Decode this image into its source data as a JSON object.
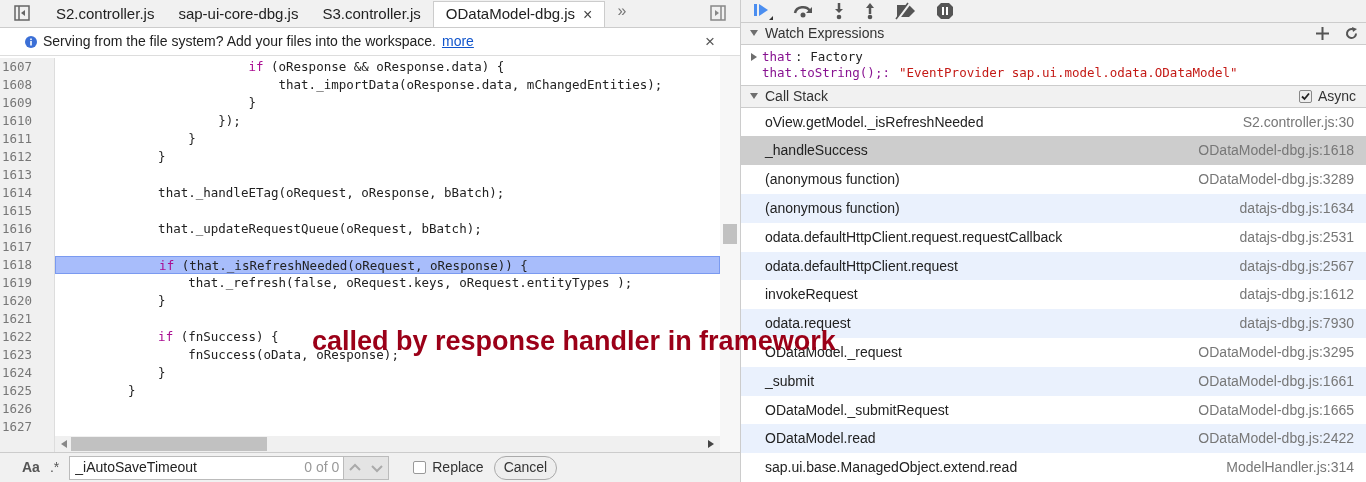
{
  "tabs": [
    {
      "label": "S2.controller.js",
      "selected": false
    },
    {
      "label": "sap-ui-core-dbg.js",
      "selected": false
    },
    {
      "label": "S3.controller.js",
      "selected": false
    },
    {
      "label": "ODataModel-dbg.js",
      "selected": true,
      "close": "×"
    }
  ],
  "more_tabs": "»",
  "infobar": {
    "message": "Serving from the file system? Add your files into the workspace.",
    "link": "more",
    "close": "×"
  },
  "code": [
    {
      "number": "1607",
      "highlighted": false,
      "segments": [
        {
          "text": "                if",
          "kind": "keyword"
        },
        {
          "text": " (oResponse && oResponse.data) {",
          "kind": "plain"
        }
      ]
    },
    {
      "number": "1608",
      "highlighted": false,
      "segments": [
        {
          "text": "                    that._importData(oResponse.data, mChangedEntities);",
          "kind": "plain"
        }
      ]
    },
    {
      "number": "1609",
      "highlighted": false,
      "segments": [
        {
          "text": "                }",
          "kind": "plain"
        }
      ]
    },
    {
      "number": "1610",
      "highlighted": false,
      "segments": [
        {
          "text": "            });",
          "kind": "plain"
        }
      ]
    },
    {
      "number": "1611",
      "highlighted": false,
      "segments": [
        {
          "text": "        }",
          "kind": "plain"
        }
      ]
    },
    {
      "number": "1612",
      "highlighted": false,
      "segments": [
        {
          "text": "    }",
          "kind": "plain"
        }
      ]
    },
    {
      "number": "1613",
      "highlighted": false
    },
    {
      "number": "1614",
      "highlighted": false,
      "segments": [
        {
          "text": "    that._handleETag(oRequest, oResponse, bBatch);",
          "kind": "plain"
        }
      ]
    },
    {
      "number": "1615",
      "highlighted": false
    },
    {
      "number": "1616",
      "highlighted": false,
      "segments": [
        {
          "text": "    that._updateRequestQueue(oRequest, bBatch);",
          "kind": "plain"
        }
      ]
    },
    {
      "number": "1617",
      "highlighted": false
    },
    {
      "number": "1618",
      "highlighted": true,
      "segments": [
        {
          "text": "    if",
          "kind": "keyword"
        },
        {
          "text": " (that._isRefreshNeeded(oRequest, oResponse)) {",
          "kind": "plain"
        }
      ]
    },
    {
      "number": "1619",
      "highlighted": false,
      "segments": [
        {
          "text": "        that._refresh(false, oRequest.keys, oRequest.entityTypes );",
          "kind": "plain"
        }
      ]
    },
    {
      "number": "1620",
      "highlighted": false,
      "segments": [
        {
          "text": "    }",
          "kind": "plain"
        }
      ]
    },
    {
      "number": "1621",
      "highlighted": false
    },
    {
      "number": "1622",
      "highlighted": false,
      "segments": [
        {
          "text": "    if",
          "kind": "keyword"
        },
        {
          "text": " (fnSuccess) {",
          "kind": "plain"
        }
      ]
    },
    {
      "number": "1623",
      "highlighted": false,
      "segments": [
        {
          "text": "        fnSuccess(oData, oResponse);",
          "kind": "plain"
        }
      ]
    },
    {
      "number": "1624",
      "highlighted": false,
      "segments": [
        {
          "text": "    }",
          "kind": "plain"
        }
      ]
    },
    {
      "number": "1625",
      "highlighted": false,
      "segments": [
        {
          "text": "}",
          "kind": "plain"
        }
      ]
    },
    {
      "number": "1626",
      "highlighted": false
    },
    {
      "number": "1627",
      "highlighted": false
    }
  ],
  "annotation": "called by response handler in framework",
  "search": {
    "case_toggle": "Aa",
    "regex_toggle": ".*",
    "value": "_iAutoSaveTimeout",
    "count": "0 of 0",
    "replace_label": "Replace",
    "replace_checked": false,
    "cancel": "Cancel"
  },
  "watch": {
    "title": "Watch Expressions",
    "expanded": true,
    "items": [
      {
        "name": "that",
        "value": ": Factory",
        "kind": "object"
      },
      {
        "name": "that.toString();:",
        "value": "\"EventProvider sap.ui.model.odata.ODataModel\"",
        "kind": "string"
      }
    ]
  },
  "call_stack": {
    "title": "Call Stack",
    "expanded": true,
    "async_label": "Async",
    "async_checked": true,
    "frames": [
      {
        "function": "oView.getModel._isRefreshNeeded",
        "location": "S2.controller.js:30",
        "selected": false,
        "async": false
      },
      {
        "function": "_handleSuccess",
        "location": "ODataModel-dbg.js:1618",
        "selected": true,
        "async": false
      },
      {
        "function": "(anonymous function)",
        "location": "ODataModel-dbg.js:3289",
        "selected": false,
        "async": false
      },
      {
        "function": "(anonymous function)",
        "location": "datajs-dbg.js:1634",
        "selected": false,
        "async": true
      },
      {
        "function": "odata.defaultHttpClient.request.requestCallback",
        "location": "datajs-dbg.js:2531",
        "selected": false,
        "async": false
      },
      {
        "function": "odata.defaultHttpClient.request",
        "location": "datajs-dbg.js:2567",
        "selected": false,
        "async": true
      },
      {
        "function": "invokeRequest",
        "location": "datajs-dbg.js:1612",
        "selected": false,
        "async": false
      },
      {
        "function": "odata.request",
        "location": "datajs-dbg.js:7930",
        "selected": false,
        "async": true
      },
      {
        "function": "ODataModel._request",
        "location": "ODataModel-dbg.js:3295",
        "selected": false,
        "async": false
      },
      {
        "function": "_submit",
        "location": "ODataModel-dbg.js:1661",
        "selected": false,
        "async": true
      },
      {
        "function": "ODataModel._submitRequest",
        "location": "ODataModel-dbg.js:1665",
        "selected": false,
        "async": false
      },
      {
        "function": "ODataModel.read",
        "location": "ODataModel-dbg.js:2422",
        "selected": false,
        "async": true
      },
      {
        "function": "sap.ui.base.ManagedObject.extend.read",
        "location": "ModelHandler.js:314",
        "selected": false,
        "async": false
      }
    ]
  }
}
